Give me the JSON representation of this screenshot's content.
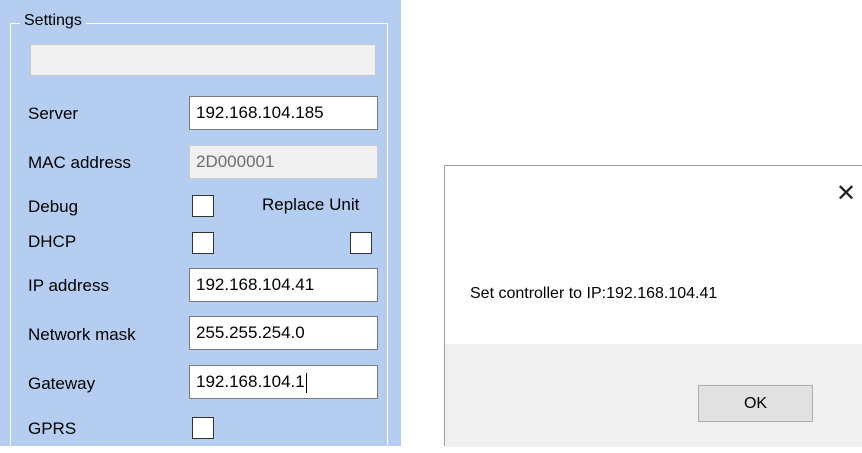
{
  "settings": {
    "group_title": "Settings",
    "status_text": "",
    "server": {
      "label": "Server",
      "value": "192.168.104.185"
    },
    "mac": {
      "label": "MAC address",
      "value": "2D000001"
    },
    "debug": {
      "label": "Debug",
      "checked": false
    },
    "replace_unit": {
      "label": "Replace Unit",
      "checked": false
    },
    "dhcp": {
      "label": "DHCP",
      "checked": false
    },
    "ip": {
      "label": "IP address",
      "value": "192.168.104.41"
    },
    "mask": {
      "label": "Network mask",
      "value": "255.255.254.0"
    },
    "gateway": {
      "label": "Gateway",
      "value": "192.168.104.1"
    },
    "gprs": {
      "label": "GPRS",
      "checked": false
    },
    "colors": {
      "panel_bg": "#b4cdf0"
    }
  },
  "dialog": {
    "close_icon": "close-icon",
    "message": "Set controller to IP:192.168.104.41",
    "ok_label": "OK"
  }
}
